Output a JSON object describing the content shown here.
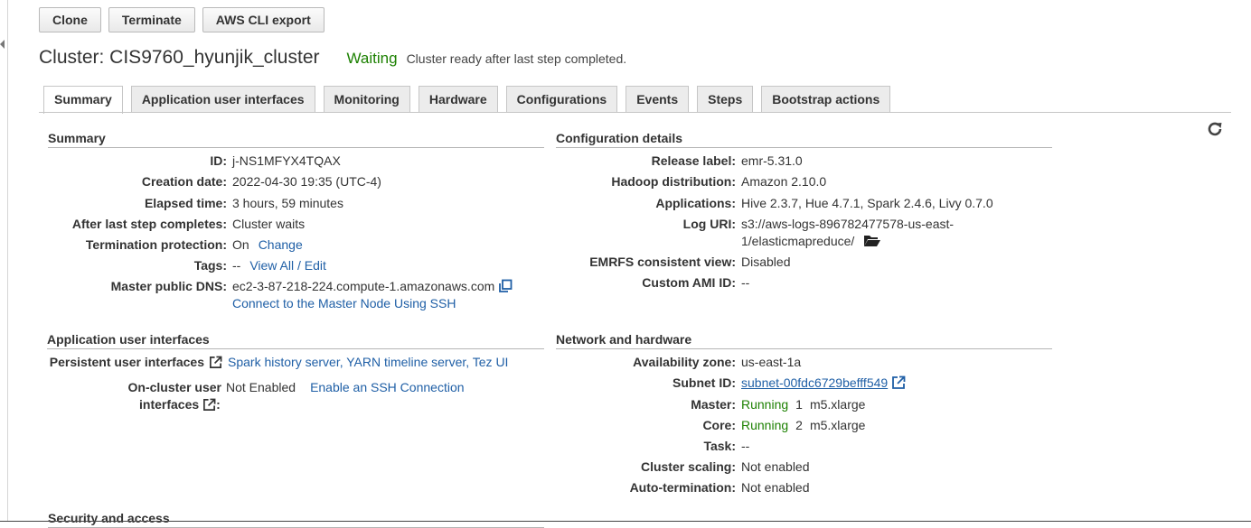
{
  "toolbar": {
    "clone": "Clone",
    "terminate": "Terminate",
    "cli_export": "AWS CLI export"
  },
  "header": {
    "title": "Cluster: CIS9760_hyunjik_cluster",
    "status": "Waiting",
    "status_detail": "Cluster ready after last step completed."
  },
  "tabs": [
    "Summary",
    "Application user interfaces",
    "Monitoring",
    "Hardware",
    "Configurations",
    "Events",
    "Steps",
    "Bootstrap actions"
  ],
  "summary": {
    "title": "Summary",
    "id_label": "ID:",
    "id": "j-NS1MFYX4TQAX",
    "creation_label": "Creation date:",
    "creation": "2022-04-30 19:35 (UTC-4)",
    "elapsed_label": "Elapsed time:",
    "elapsed": "3 hours, 59 minutes",
    "after_label": "After last step completes:",
    "after": "Cluster waits",
    "termination_label": "Termination protection:",
    "termination": "On",
    "termination_link": "Change",
    "tags_label": "Tags:",
    "tags": "--",
    "tags_link": "View All / Edit",
    "dns_label": "Master public DNS:",
    "dns": "ec2-3-87-218-224.compute-1.amazonaws.com",
    "ssh_link": "Connect to the Master Node Using SSH"
  },
  "config": {
    "title": "Configuration details",
    "release_label": "Release label:",
    "release": "emr-5.31.0",
    "hadoop_label": "Hadoop distribution:",
    "hadoop": "Amazon 2.10.0",
    "apps_label": "Applications:",
    "apps": "Hive 2.3.7, Hue 4.7.1, Spark 2.4.6, Livy 0.7.0",
    "log_label": "Log URI:",
    "log_line1": "s3://aws-logs-896782477578-us-east-",
    "log_line2": "1/elasticmapreduce/",
    "emrfs_label": "EMRFS consistent view:",
    "emrfs": "Disabled",
    "ami_label": "Custom AMI ID:",
    "ami": "--"
  },
  "app_ui": {
    "title": "Application user interfaces",
    "persistent_label": "Persistent user interfaces",
    "persistent": "Spark history server, YARN timeline server, Tez UI",
    "oncluster_label1": "On-cluster user",
    "oncluster_label2": "interfaces",
    "oncluster": "Not Enabled",
    "oncluster_link": "Enable an SSH Connection"
  },
  "network": {
    "title": "Network and hardware",
    "az_label": "Availability zone:",
    "az": "us-east-1a",
    "subnet_label": "Subnet ID:",
    "subnet": "subnet-00fdc6729befff549",
    "master_label": "Master:",
    "master_status": "Running",
    "master_count": "1",
    "master_type": "m5.xlarge",
    "core_label": "Core:",
    "core_status": "Running",
    "core_count": "2",
    "core_type": "m5.xlarge",
    "task_label": "Task:",
    "task": "--",
    "scaling_label": "Cluster scaling:",
    "scaling": "Not enabled",
    "autoterm_label": "Auto-termination:",
    "autoterm": "Not enabled"
  },
  "security": {
    "title": "Security and access"
  },
  "colors": {
    "status_green": "#1d8102",
    "link_blue": "#1f5fa6"
  }
}
